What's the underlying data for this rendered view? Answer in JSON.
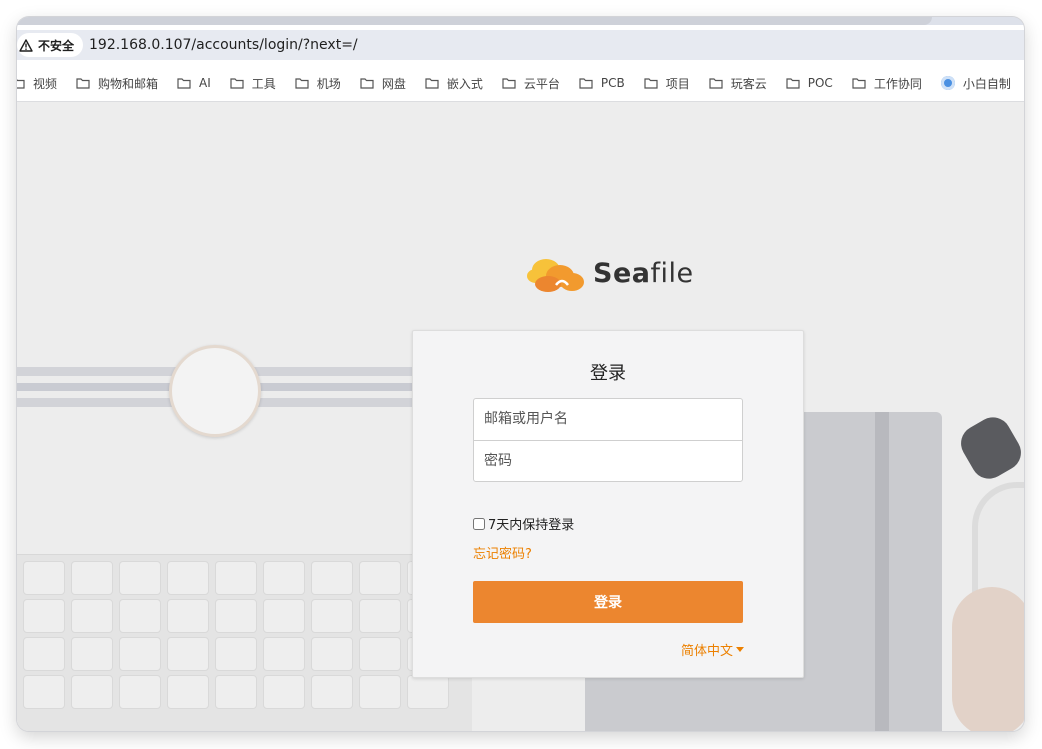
{
  "browser": {
    "security_label": "不安全",
    "url": "192.168.0.107/accounts/login/?next=/",
    "bookmarks": [
      "视频",
      "购物和邮箱",
      "AI",
      "工具",
      "机场",
      "网盘",
      "嵌入式",
      "云平台",
      "PCB",
      "项目",
      "玩客云",
      "POC",
      "工作协同",
      "小白自制"
    ]
  },
  "login": {
    "logo_text_bold": "Sea",
    "logo_text_light": "file",
    "title": "登录",
    "username_placeholder": "邮箱或用户名",
    "password_placeholder": "密码",
    "remember_label": "7天内保持登录",
    "forgot_link": "忘记密码?",
    "submit_label": "登录",
    "language": "简体中文"
  },
  "colors": {
    "accent": "#ec862f",
    "link": "#ec8000"
  }
}
